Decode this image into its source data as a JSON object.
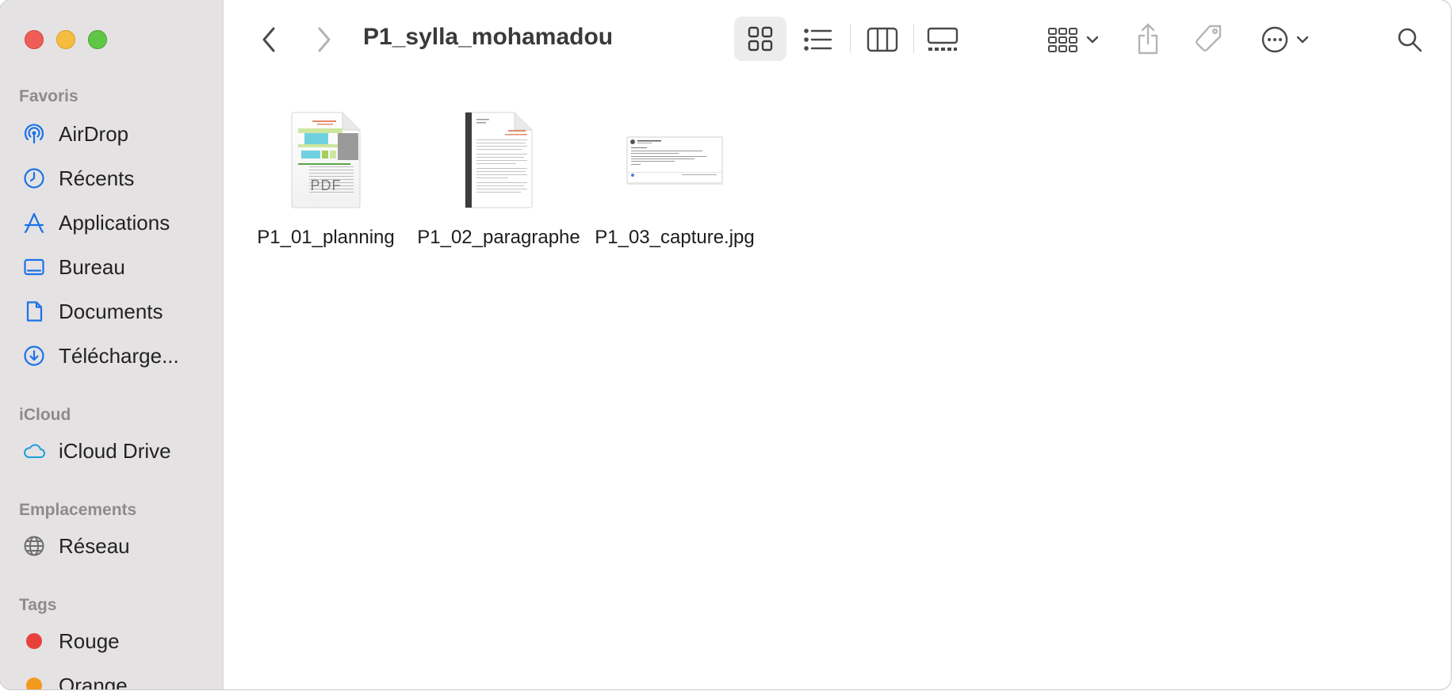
{
  "window": {
    "title": "P1_sylla_mohamadou"
  },
  "sidebar": {
    "sections": [
      {
        "title": "Favoris",
        "items": [
          {
            "label": "AirDrop",
            "icon": "airdrop-icon"
          },
          {
            "label": "Récents",
            "icon": "clock-icon"
          },
          {
            "label": "Applications",
            "icon": "applications-icon"
          },
          {
            "label": "Bureau",
            "icon": "desktop-icon"
          },
          {
            "label": "Documents",
            "icon": "document-icon"
          },
          {
            "label": "Télécharge...",
            "icon": "download-icon"
          }
        ]
      },
      {
        "title": "iCloud",
        "items": [
          {
            "label": "iCloud Drive",
            "icon": "cloud-icon"
          }
        ]
      },
      {
        "title": "Emplacements",
        "items": [
          {
            "label": "Réseau",
            "icon": "globe-icon"
          }
        ]
      },
      {
        "title": "Tags",
        "items": [
          {
            "label": "Rouge",
            "color": "#e8413b"
          },
          {
            "label": "Orange",
            "color": "#f39a1d"
          }
        ]
      }
    ]
  },
  "files": [
    {
      "name": "P1_01_planning",
      "type_label": "PDF"
    },
    {
      "name": "P1_02_paragraphe"
    },
    {
      "name": "P1_03_capture.jpg"
    }
  ],
  "colors": {
    "accent": "#1a73e8",
    "sidebar_bg": "#e5e2e4"
  }
}
